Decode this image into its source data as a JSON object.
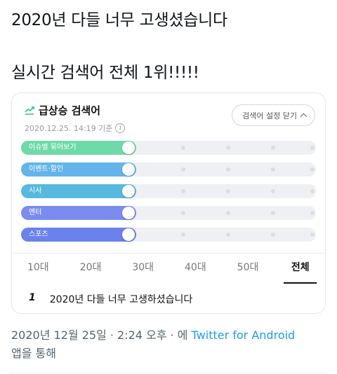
{
  "tweet": {
    "line1": "2020년 다들 너무 고생셨습니다",
    "line2": "실시간 검색어  전체 1위!!!!!"
  },
  "card": {
    "title": "급상승 검색어",
    "timestamp": "2020.12.25. 14:19 기준",
    "info_icon": "i",
    "settings_button": "검색어 설정 닫기",
    "colors": {
      "issue": "#6fdaa9",
      "event": "#62b4ea",
      "news": "#57b9dd",
      "entertainment": "#7b8cf0",
      "sports": "#6a82ec",
      "trend_icon": "#38c79b"
    },
    "filters": [
      {
        "label": "이슈별 묶어보기",
        "enabled": true
      },
      {
        "label": "이벤트·할인",
        "enabled": true
      },
      {
        "label": "시사",
        "enabled": true
      },
      {
        "label": "엔터",
        "enabled": true
      },
      {
        "label": "스포츠",
        "enabled": true
      }
    ],
    "tabs": [
      "10대",
      "20대",
      "30대",
      "40대",
      "50대",
      "전체"
    ],
    "active_tab": "전체",
    "result": {
      "rank": "1",
      "term": "2020년 다들 너무 고생하셨습니다"
    }
  },
  "meta": {
    "date": "2020년 12월 25일 · 2:24 오후 · 에 ",
    "source": "Twitter for Android",
    "suffix": "앱을 통해"
  }
}
